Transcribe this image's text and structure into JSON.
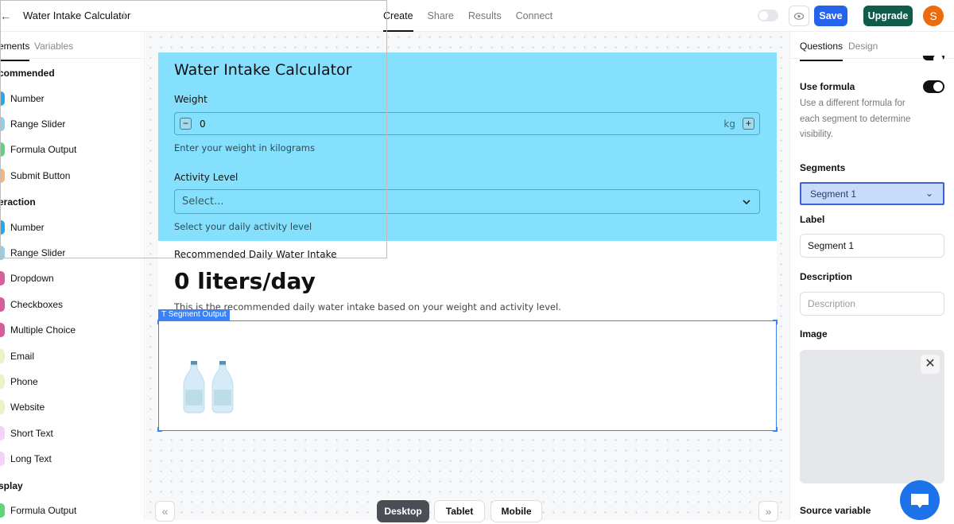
{
  "header": {
    "back_glyph": "←",
    "title": "Water Intake Calculator",
    "tabs": [
      {
        "label": "Create",
        "active": true
      },
      {
        "label": "Share",
        "active": false
      },
      {
        "label": "Results",
        "active": false
      },
      {
        "label": "Connect",
        "active": false
      }
    ],
    "preview_icon": "eye-icon",
    "save_label": "Save",
    "upgrade_label": "Upgrade",
    "avatar_initial": "S",
    "colors": {
      "save": "#2563eb",
      "upgrade": "#0f5c4a",
      "avatar": "#ea6c0c"
    }
  },
  "left_panel": {
    "tabs": [
      {
        "label": "Elements",
        "visible": "ements",
        "active": true
      },
      {
        "label": "Variables",
        "active": false
      }
    ],
    "sections": [
      {
        "title": "commended",
        "items": [
          {
            "label": "Number",
            "color": "#2aa7e8"
          },
          {
            "label": "Range Slider",
            "color": "#8ecff2"
          },
          {
            "label": "Formula Output",
            "color": "#5fd47a"
          },
          {
            "label": "Submit Button",
            "color": "#f7b57b"
          }
        ]
      },
      {
        "title": "eraction",
        "items": [
          {
            "label": "Number",
            "color": "#2aa7e8"
          },
          {
            "label": "Range Slider",
            "color": "#8ecff2"
          },
          {
            "label": "Dropdown",
            "color": "#d65f9b"
          },
          {
            "label": "Checkboxes",
            "color": "#d65f9b"
          },
          {
            "label": "Multiple Choice",
            "color": "#d65f9b"
          },
          {
            "label": "Email",
            "color": "#e6f5c9"
          },
          {
            "label": "Phone",
            "color": "#e6f5c9"
          },
          {
            "label": "Website",
            "color": "#e6f5c9"
          },
          {
            "label": "Short Text",
            "color": "#f2d3f7"
          },
          {
            "label": "Long Text",
            "color": "#f2d3f7"
          }
        ]
      },
      {
        "title": "splay",
        "items": [
          {
            "label": "Formula Output",
            "color": "#5fd47a"
          }
        ]
      }
    ]
  },
  "form": {
    "title": "Water Intake Calculator",
    "weight": {
      "label": "Weight",
      "value": "0",
      "unit": "kg",
      "help": "Enter your weight in kilograms",
      "minus": "−",
      "plus": "+"
    },
    "activity": {
      "label": "Activity Level",
      "placeholder": "Select...",
      "help": "Select your daily activity level"
    },
    "result": {
      "label": "Recommended Daily Water Intake",
      "value": "0 liters/day",
      "description": "This is the recommended daily water intake based on your weight and activity level."
    },
    "segment_output": {
      "tag": "Segment Output",
      "image": "water-bottles"
    },
    "background": "#84e0fc"
  },
  "device_bar": {
    "prev": "«",
    "next": "»",
    "devices": [
      {
        "label": "Desktop",
        "active": true
      },
      {
        "label": "Tablet",
        "active": false
      },
      {
        "label": "Mobile",
        "active": false
      }
    ]
  },
  "right_panel": {
    "tabs": [
      {
        "label": "Questions",
        "active": true
      },
      {
        "label": "Design",
        "active": false
      }
    ],
    "use_formula": {
      "label": "Use formula",
      "enabled": true,
      "description": "Use a different formula for each segment to determine visibility."
    },
    "segments": {
      "label": "Segments",
      "selected": "Segment 1"
    },
    "label_field": {
      "label": "Label",
      "value": "Segment 1"
    },
    "description_field": {
      "label": "Description",
      "placeholder": "Description",
      "value": ""
    },
    "image": {
      "label": "Image",
      "close": "✕"
    },
    "source_variable": {
      "label": "Source variable"
    }
  }
}
